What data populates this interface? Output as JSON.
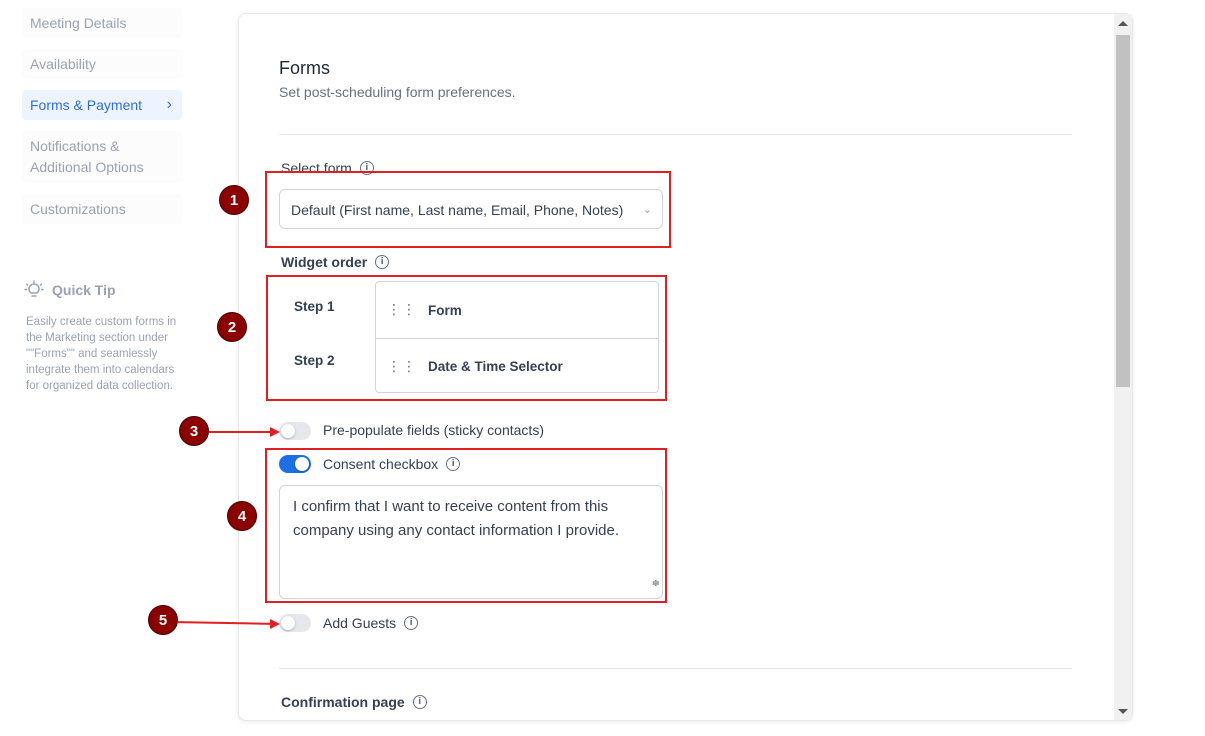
{
  "sidebar": {
    "items": [
      {
        "label": "Meeting Details"
      },
      {
        "label": "Availability"
      },
      {
        "label": "Forms & Payment"
      },
      {
        "label": "Notifications & Additional Options"
      },
      {
        "label": "Customizations"
      }
    ],
    "active_chevron": "›"
  },
  "quick_tip": {
    "title": "Quick Tip",
    "icon": "lightbulb-icon",
    "text": "Easily create custom forms in the Marketing section under \"\"Forms\"\" and seamlessly integrate them into calendars for organized data collection."
  },
  "forms": {
    "title": "Forms",
    "subtitle": "Set post-scheduling form preferences.",
    "select_form_label": "Select form",
    "select_form_value": "Default (First name, Last name, Email, Phone, Notes)",
    "widget_order_label": "Widget order",
    "steps": [
      {
        "step": "Step 1",
        "widget": "Form"
      },
      {
        "step": "Step 2",
        "widget": "Date & Time Selector"
      }
    ],
    "prepopulate_label": "Pre-populate fields (sticky contacts)",
    "prepopulate_on": false,
    "consent_label": "Consent checkbox",
    "consent_on": true,
    "consent_text": "I confirm that I want to receive content from this company using any contact information I provide.",
    "add_guests_label": "Add Guests",
    "add_guests_on": false,
    "confirmation_label": "Confirmation page"
  },
  "annotations": {
    "badges": [
      "1",
      "2",
      "3",
      "4",
      "5"
    ],
    "highlight_color": "#e02020",
    "badge_color": "#8b0000"
  },
  "colors": {
    "accent": "#1e6ee6",
    "active_nav_bg": "#eef4ff",
    "active_nav_text": "#2f6fd7"
  }
}
